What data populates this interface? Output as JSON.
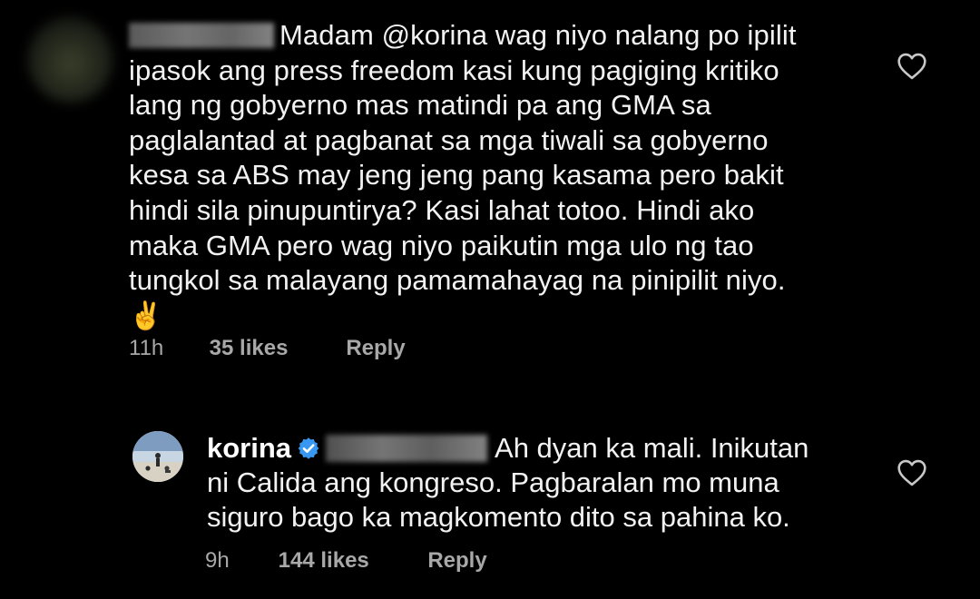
{
  "comments": [
    {
      "username": "",
      "mention": "@korina",
      "lines": [
        "Madam @korina wag niyo nalang po ipilit",
        "ipasok ang press freedom kasi kung pagiging kritiko",
        "lang ng gobyerno mas matindi pa ang GMA sa",
        "paglalantad at pagbanat sa mga tiwali sa gobyerno",
        "kesa sa ABS may jeng jeng pang kasama pero bakit",
        "hindi sila pinupuntirya? Kasi lahat totoo. Hindi ako",
        "maka GMA pero wag niyo paikutin mga ulo ng tao",
        "tungkol sa malayang pamamahayag na pinipilit niyo."
      ],
      "emoji": "✌️",
      "time": "11h",
      "likes": "35 likes",
      "reply": "Reply"
    },
    {
      "username": "korina",
      "verified": true,
      "lines": [
        "Ah dyan ka mali. Inikutan",
        "ni Calida ang kongreso. Pagbaralan mo muna",
        "siguro bago ka magkomento dito sa pahina ko."
      ],
      "time": "9h",
      "likes": "144 likes",
      "reply": "Reply"
    }
  ],
  "colors": {
    "background": "#000000",
    "text": "#f2f2f2",
    "meta": "#a8a8a8",
    "verified": "#3897f0"
  },
  "icons": {
    "like": "heart-outline-icon",
    "verified": "verified-badge-icon"
  }
}
